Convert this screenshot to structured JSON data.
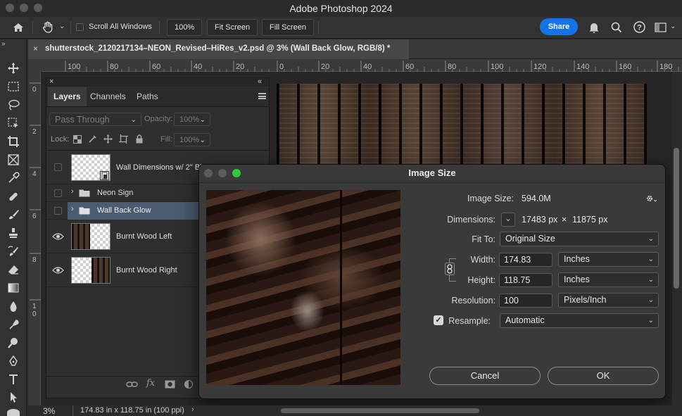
{
  "window": {
    "title": "Adobe Photoshop 2024"
  },
  "options_bar": {
    "scroll_all_label": "Scroll All Windows",
    "zoom_btn": "100%",
    "fit_screen_btn": "Fit Screen",
    "fill_screen_btn": "Fill Screen",
    "share_btn": "Share"
  },
  "document": {
    "tab_title": "shutterstock_2120217134–NEON_Revised–HiRes_v2.psd @ 3% (Wall Back Glow, RGB/8) *"
  },
  "rulers": {
    "h_labels": [
      "100",
      "80",
      "60",
      "40",
      "20",
      "0",
      "20",
      "40",
      "60",
      "80",
      "100",
      "120",
      "140",
      "160",
      "180"
    ],
    "v_labels": [
      "0",
      "2",
      "4",
      "6",
      "8",
      "10"
    ]
  },
  "layers_panel": {
    "tabs": [
      "Layers",
      "Channels",
      "Paths"
    ],
    "blend_mode": "Pass Through",
    "opacity_label": "Opacity:",
    "opacity_value": "100%",
    "lock_label": "Lock:",
    "fill_label": "Fill:",
    "fill_value": "100%",
    "layers": [
      {
        "name": "Wall Dimensions w/ 2\" Bl",
        "visible": false
      },
      {
        "name": "Neon Sign",
        "visible": false
      },
      {
        "name": "Wall Back Glow",
        "visible": false,
        "selected": true
      },
      {
        "name": "Burnt Wood Left",
        "visible": true
      },
      {
        "name": "Burnt Wood Right",
        "visible": true
      }
    ]
  },
  "dialog": {
    "title": "Image Size",
    "image_size_label": "Image Size:",
    "image_size_value": "594.0M",
    "dimensions_label": "Dimensions:",
    "dim_width": "17483 px",
    "dim_x": "×",
    "dim_height": "11875 px",
    "fit_to_label": "Fit To:",
    "fit_to_value": "Original Size",
    "width_label": "Width:",
    "width_value": "174.83",
    "width_unit": "Inches",
    "height_label": "Height:",
    "height_value": "118.75",
    "height_unit": "Inches",
    "resolution_label": "Resolution:",
    "resolution_value": "100",
    "resolution_unit": "Pixels/Inch",
    "resample_label": "Resample:",
    "resample_value": "Automatic",
    "resample_checked": true,
    "cancel_btn": "Cancel",
    "ok_btn": "OK"
  },
  "status_bar": {
    "zoom": "3%",
    "doc_info": "174.83 in x 118.75 in (100 ppi)"
  },
  "colors": {
    "accent": "#1473e6",
    "selected_layer": "#4b5c72"
  }
}
